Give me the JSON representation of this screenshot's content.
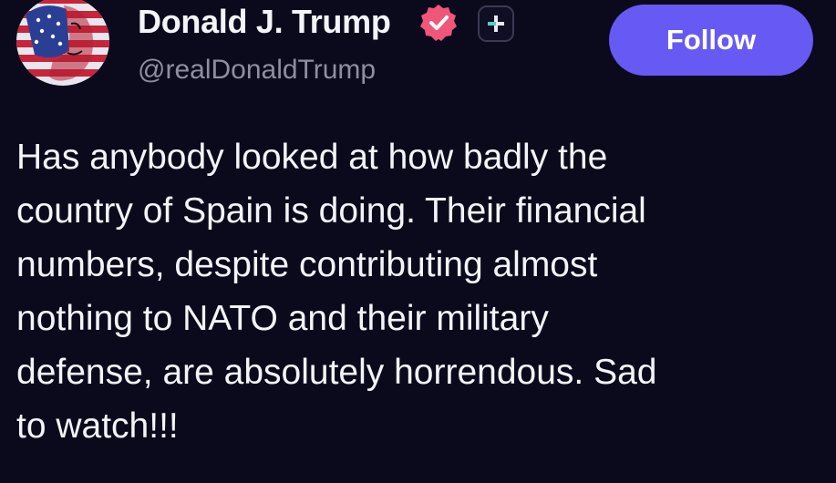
{
  "author": {
    "display_name": "Donald J. Trump",
    "handle": "@realDonaldTrump",
    "avatar_icon": "avatar-flag-portrait",
    "verified_icon": "verified-badge-icon",
    "plus_icon": "plus-badge-icon"
  },
  "actions": {
    "follow_label": "Follow"
  },
  "post": {
    "lines": [
      "Has anybody looked at how badly the",
      "country of Spain is doing. Their financial",
      "numbers, despite contributing almost",
      "nothing to NATO and their military",
      "defense, are absolutely horrendous. Sad",
      "to watch!!!"
    ]
  },
  "colors": {
    "background": "#0b0a1c",
    "text": "#f4f3f8",
    "handle": "#8f8da3",
    "accent": "#6659f4",
    "verified": "#f0567a"
  }
}
